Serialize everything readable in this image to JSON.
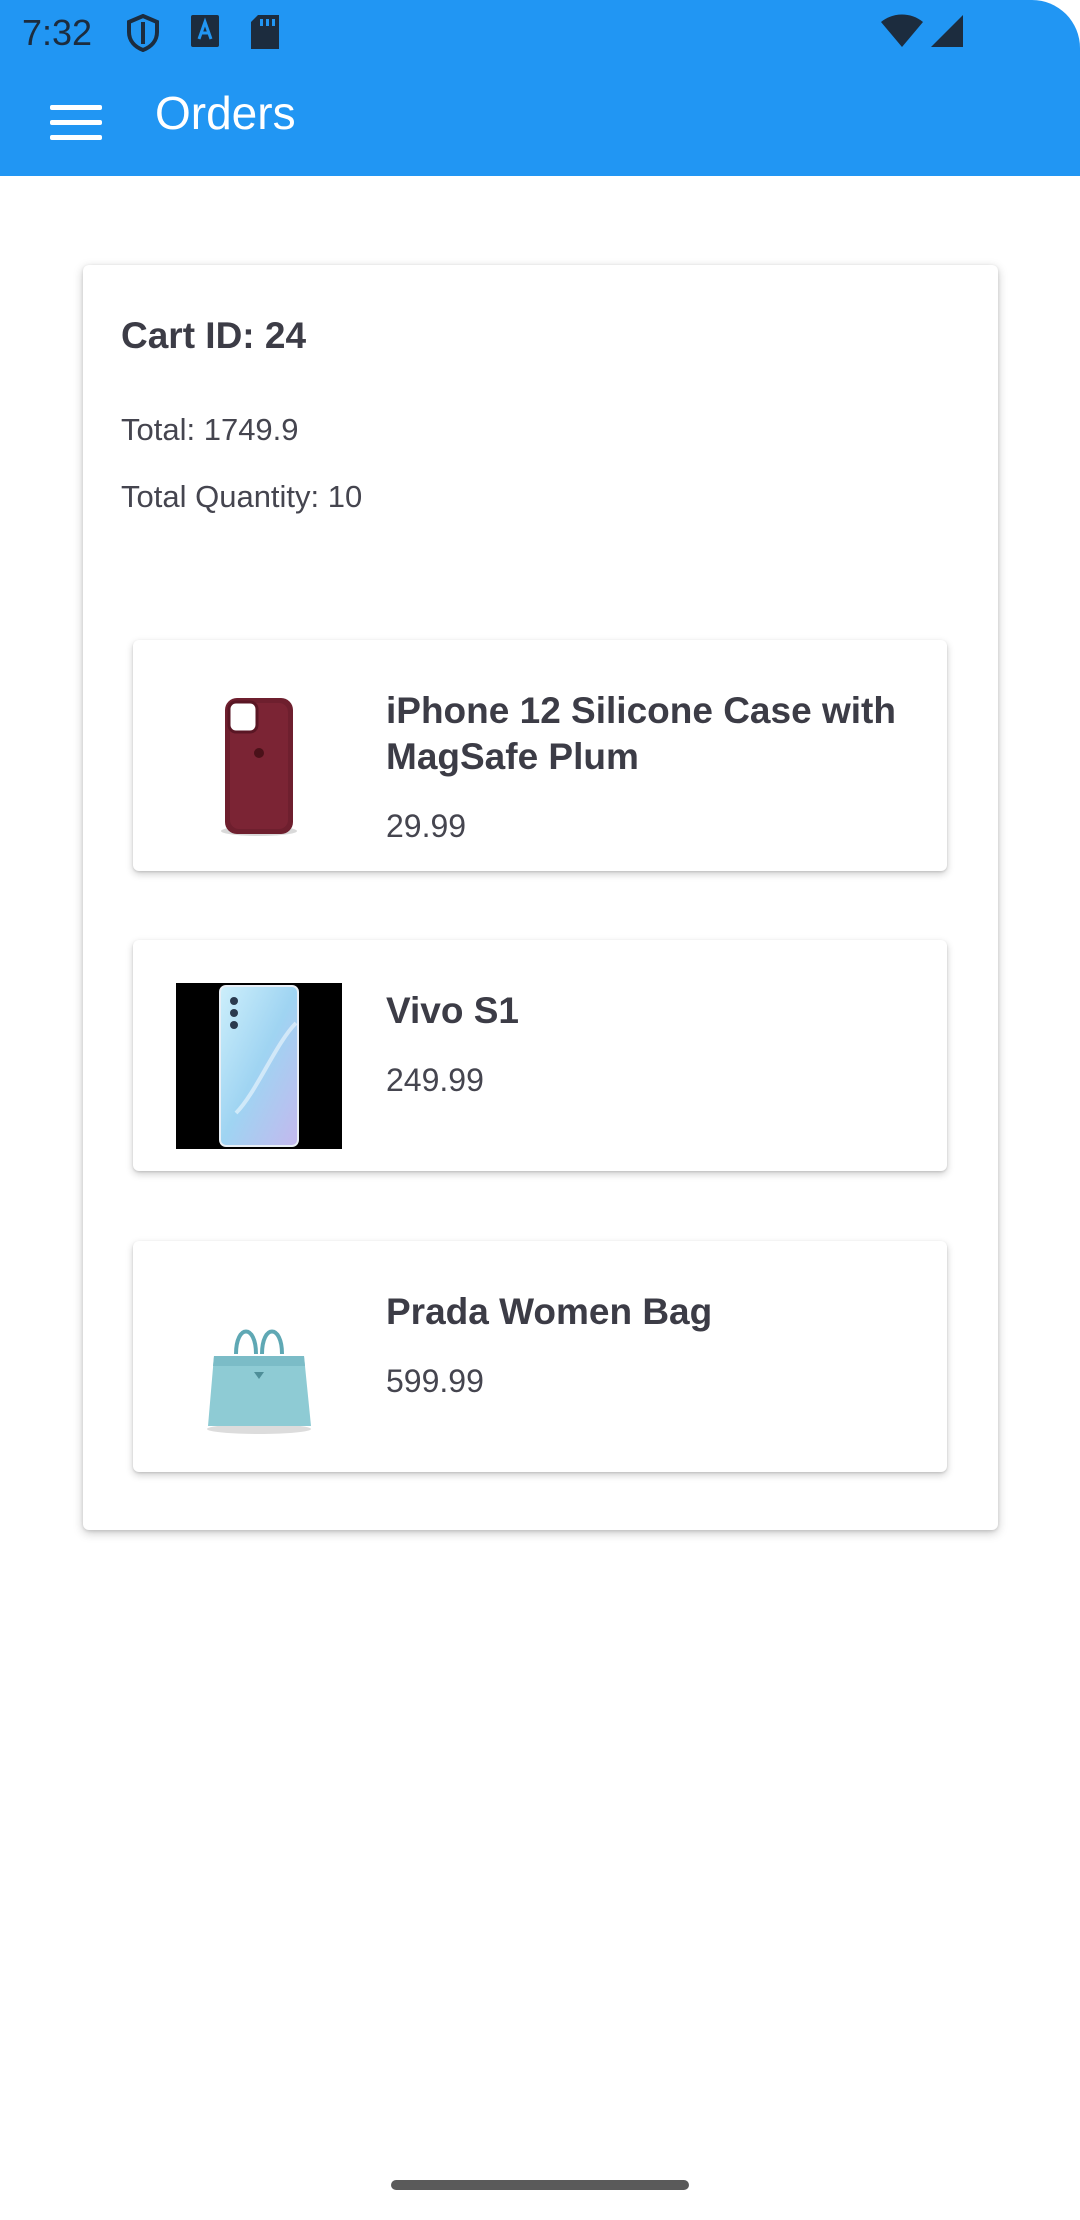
{
  "status_bar": {
    "time": "7:32",
    "icons": [
      "shield-icon",
      "font-a-icon",
      "sd-card-icon",
      "wifi-icon",
      "signal-icon"
    ]
  },
  "app_bar": {
    "title": "Orders",
    "menu_icon": "hamburger-menu-icon",
    "color": "#2196F3"
  },
  "cart": {
    "id_label": "Cart ID: 24",
    "total_label": "Total: 1749.9",
    "quantity_label": "Total Quantity: 10",
    "products": [
      {
        "name": "iPhone 12 Silicone Case with MagSafe Plum",
        "price": "29.99",
        "image": "phone-case-image"
      },
      {
        "name": "Vivo S1",
        "price": "249.99",
        "image": "smartphone-image"
      },
      {
        "name": "Prada Women Bag",
        "price": "599.99",
        "image": "handbag-image"
      }
    ]
  }
}
